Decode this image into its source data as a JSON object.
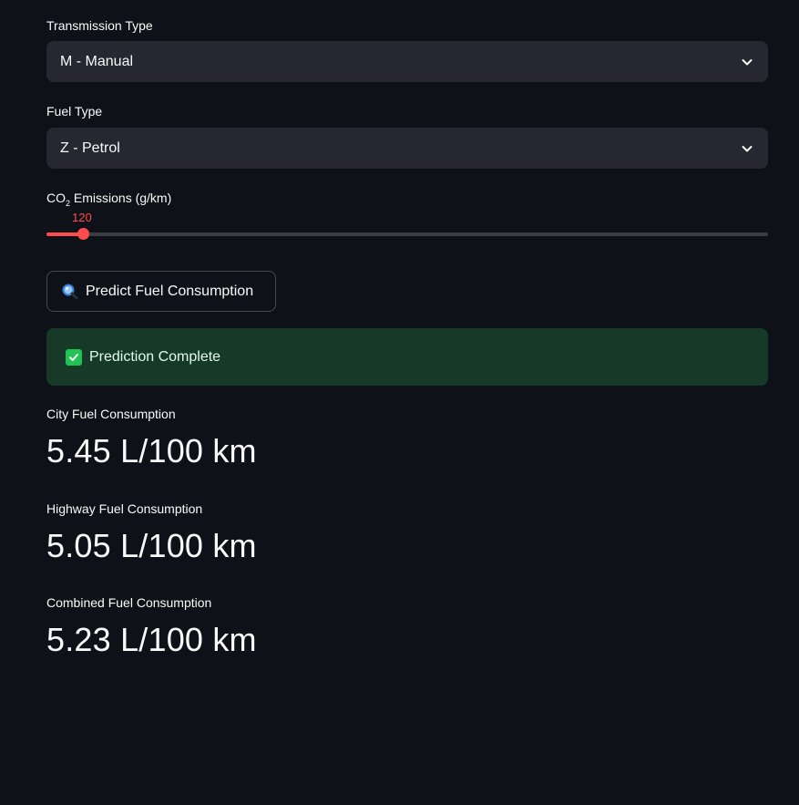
{
  "transmission": {
    "label": "Transmission Type",
    "value": "M - Manual"
  },
  "fuel": {
    "label": "Fuel Type",
    "value": "Z - Petrol"
  },
  "co2": {
    "label_prefix": "CO",
    "label_sub": "2",
    "label_suffix": " Emissions (g/km)",
    "value": "120",
    "accent_color": "#ff4b4b"
  },
  "predict_button": {
    "label": "Predict Fuel Consumption",
    "icon": "magnifier-icon"
  },
  "alert": {
    "text": "Prediction Complete",
    "icon": "check-icon",
    "color": "#21c354"
  },
  "metrics": [
    {
      "label": "City Fuel Consumption",
      "value": "5.45 L/100 km"
    },
    {
      "label": "Highway Fuel Consumption",
      "value": "5.05 L/100 km"
    },
    {
      "label": "Combined Fuel Consumption",
      "value": "5.23 L/100 km"
    }
  ]
}
